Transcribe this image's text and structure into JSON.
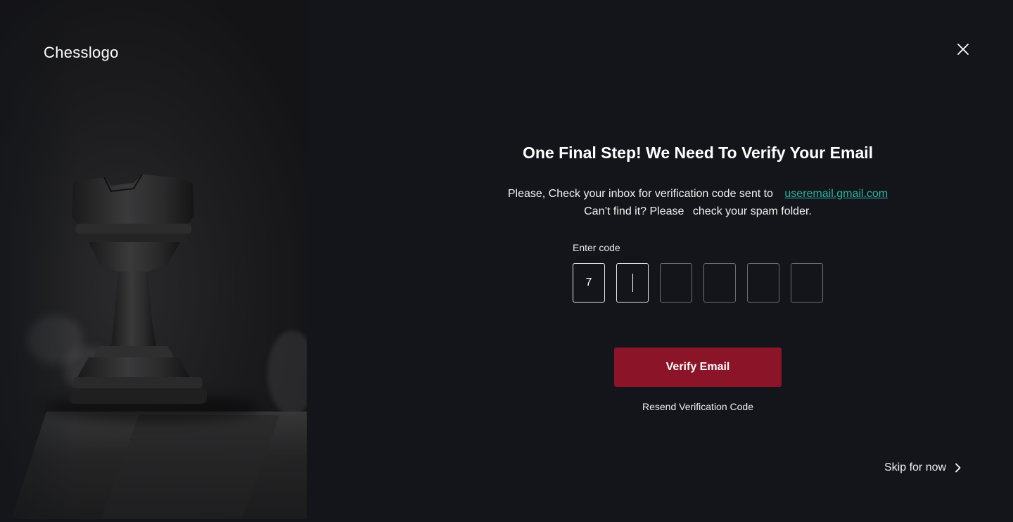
{
  "brand": {
    "logo_text": "Chesslogo"
  },
  "header": {
    "close_icon": "close-icon"
  },
  "verify": {
    "title": "One Final Step!  We Need To Verify Your Email",
    "line1_text": "Please, Check your inbox for verification code sent to",
    "email": "useremail.gmail.com",
    "line2_text": "Can’t find it? Please",
    "line2_rest": "check your spam folder.",
    "code_label": "Enter code",
    "code_digits": [
      "7",
      "",
      "",
      "",
      "",
      ""
    ],
    "active_index": 1,
    "verify_button": "Verify Email",
    "resend_link": "Resend Verification Code",
    "skip_link": "Skip for now",
    "skip_icon": "chevron-right-icon"
  },
  "colors": {
    "background": "#13151a",
    "accent_button": "#8b1428",
    "link_email": "#2bb3a3",
    "input_border": "#6c6f76",
    "input_border_active": "#e6e6e6"
  }
}
